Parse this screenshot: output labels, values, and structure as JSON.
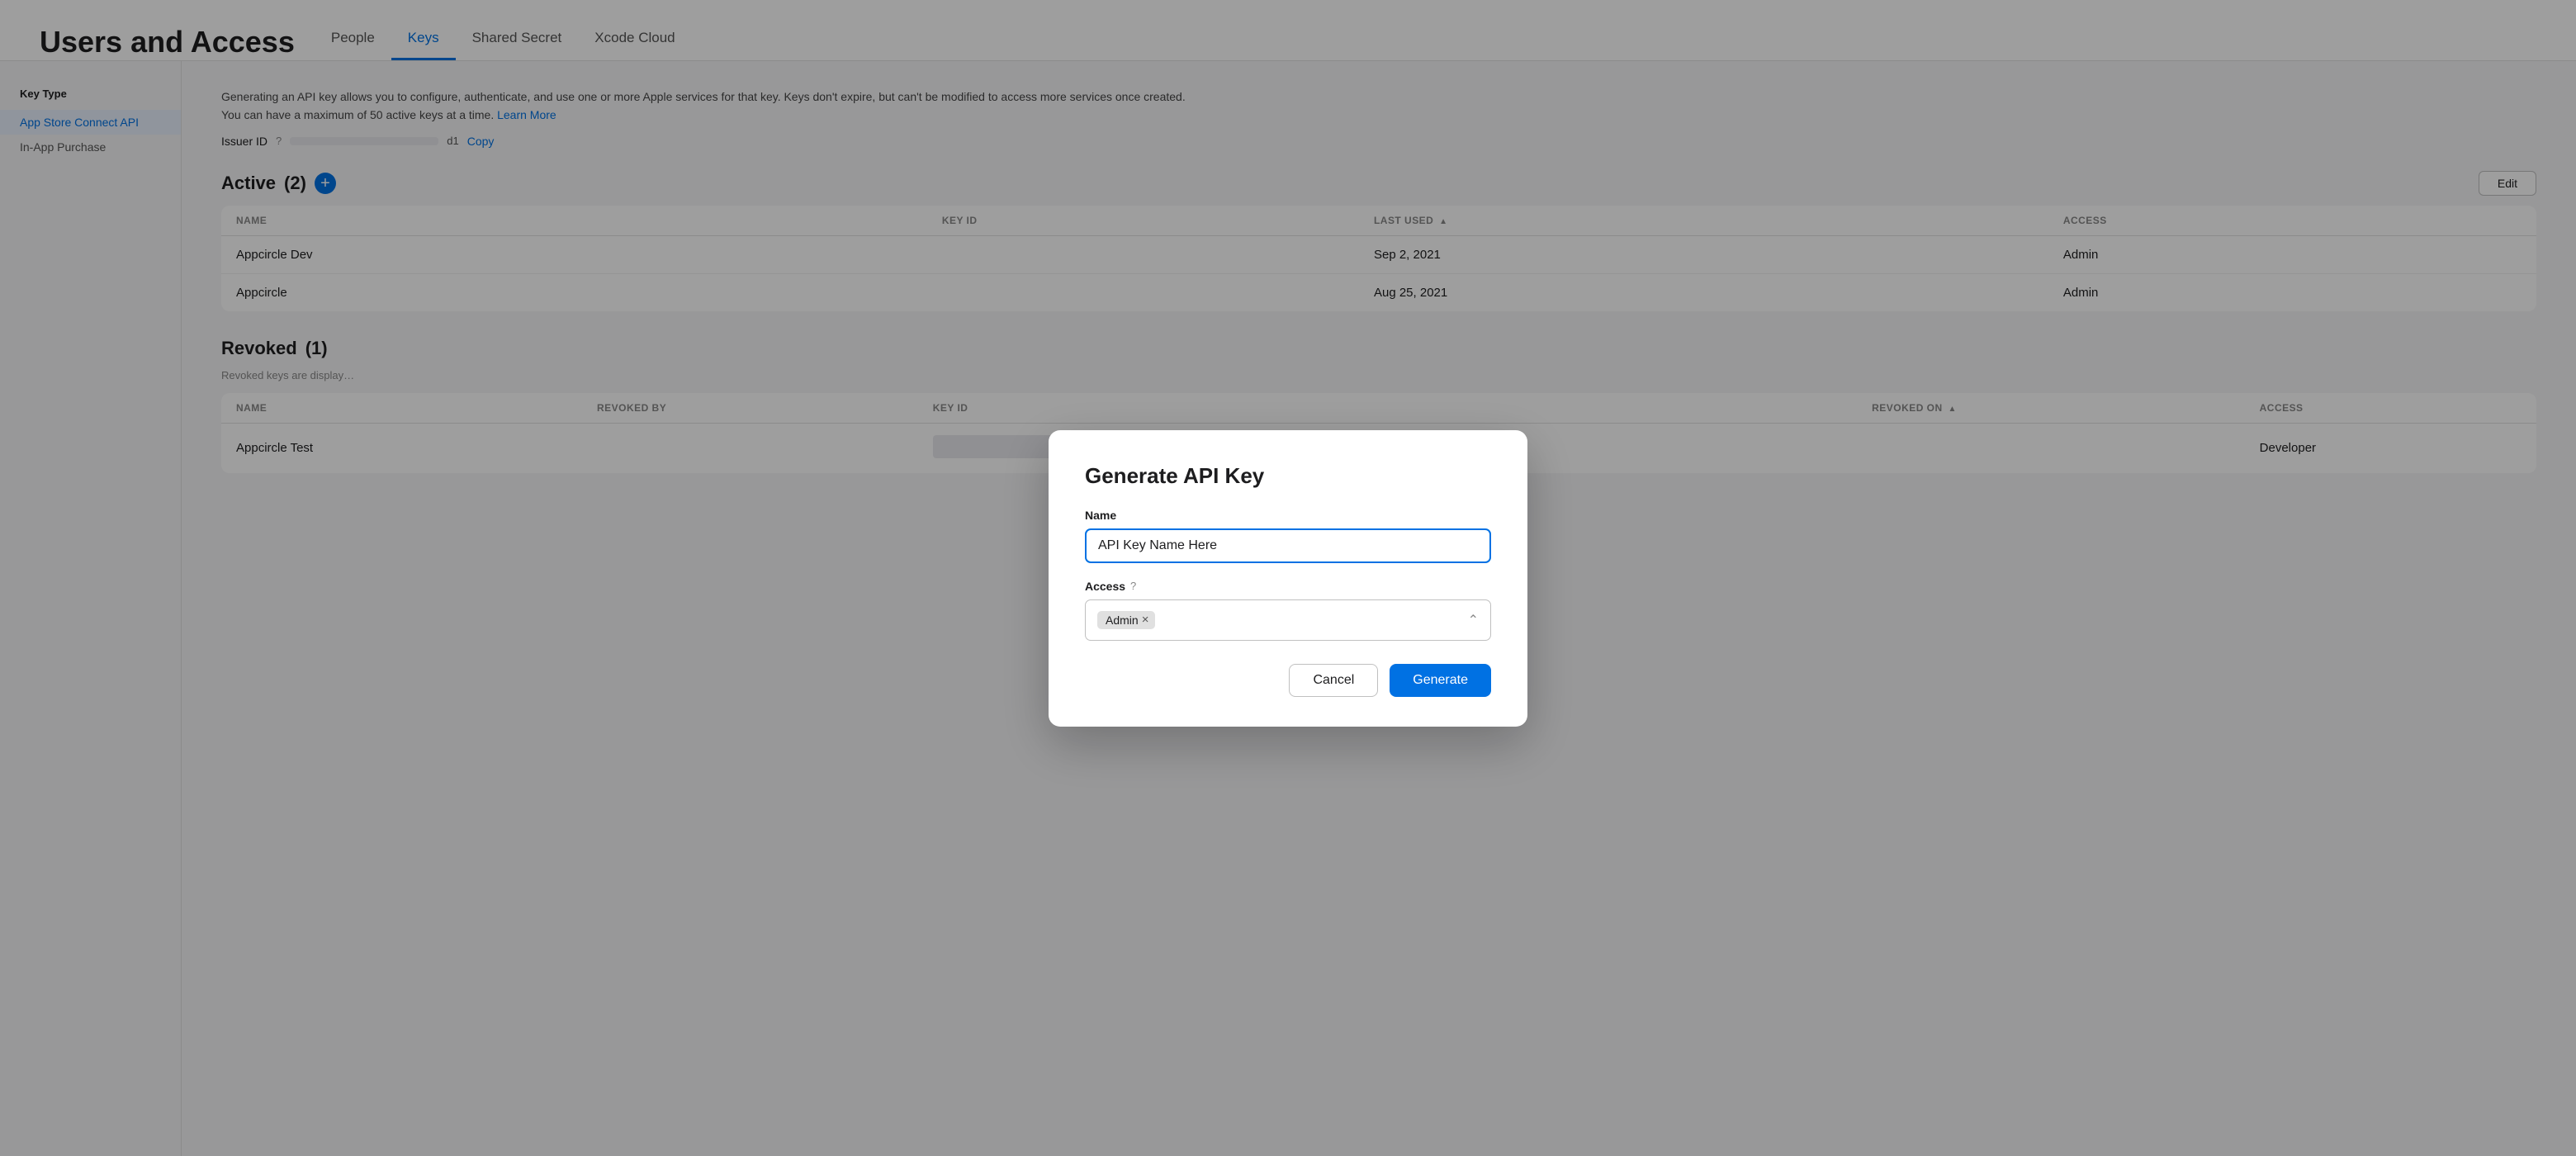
{
  "page": {
    "title": "Users and Access"
  },
  "nav": {
    "tabs": [
      {
        "id": "people",
        "label": "People",
        "active": false
      },
      {
        "id": "keys",
        "label": "Keys",
        "active": true
      },
      {
        "id": "shared-secret",
        "label": "Shared Secret",
        "active": false
      },
      {
        "id": "xcode-cloud",
        "label": "Xcode Cloud",
        "active": false
      }
    ]
  },
  "sidebar": {
    "section_title": "Key Type",
    "items": [
      {
        "id": "app-store-connect-api",
        "label": "App Store Connect API",
        "active": true
      },
      {
        "id": "in-app-purchase",
        "label": "In-App Purchase",
        "active": false
      }
    ]
  },
  "keys_page": {
    "info_text": "Generating an API key allows you to configure, authenticate, and use one or more Apple services for that key. Keys don't expire, but can't be modified to access more services once created.",
    "info_suffix": "You can have a maximum of 50 active keys at a time.",
    "learn_more_label": "Learn More",
    "issuer_label": "Issuer ID",
    "issuer_help": "?",
    "issuer_id_value": "",
    "issuer_id_suffix": "d1",
    "copy_label": "Copy",
    "active_section": {
      "title": "Active",
      "count": "(2)",
      "edit_label": "Edit",
      "columns": [
        {
          "id": "name",
          "label": "NAME"
        },
        {
          "id": "key-id",
          "label": "KEY ID"
        },
        {
          "id": "last-used",
          "label": "LAST USED",
          "sortable": true
        },
        {
          "id": "access",
          "label": "ACCESS"
        }
      ],
      "rows": [
        {
          "name": "Appcircle Dev",
          "key_id": "",
          "last_used": "Sep 2, 2021",
          "access": "Admin"
        },
        {
          "name": "Appcircle",
          "key_id": "",
          "last_used": "Aug 25, 2021",
          "access": "Admin"
        }
      ]
    },
    "revoked_section": {
      "title": "Revoked",
      "count": "(1)",
      "info_text": "Revoked keys are display…",
      "columns": [
        {
          "id": "name",
          "label": "NAME"
        },
        {
          "id": "revoked-by",
          "label": "REVOKED BY"
        },
        {
          "id": "key-id",
          "label": "KEY ID"
        },
        {
          "id": "revoked-on",
          "label": "REVOKED ON",
          "sortable": true
        },
        {
          "id": "access",
          "label": "ACCESS"
        }
      ],
      "rows": [
        {
          "name": "Appcircle Test",
          "revoked_by": "",
          "key_id": "",
          "revoked_on": "",
          "access": "Developer"
        }
      ]
    }
  },
  "modal": {
    "title": "Generate API Key",
    "name_label": "Name",
    "name_placeholder": "API Key Name Here",
    "name_value": "API Key Name Here",
    "access_label": "Access",
    "access_help": "?",
    "selected_access": "Admin",
    "cancel_label": "Cancel",
    "generate_label": "Generate"
  }
}
